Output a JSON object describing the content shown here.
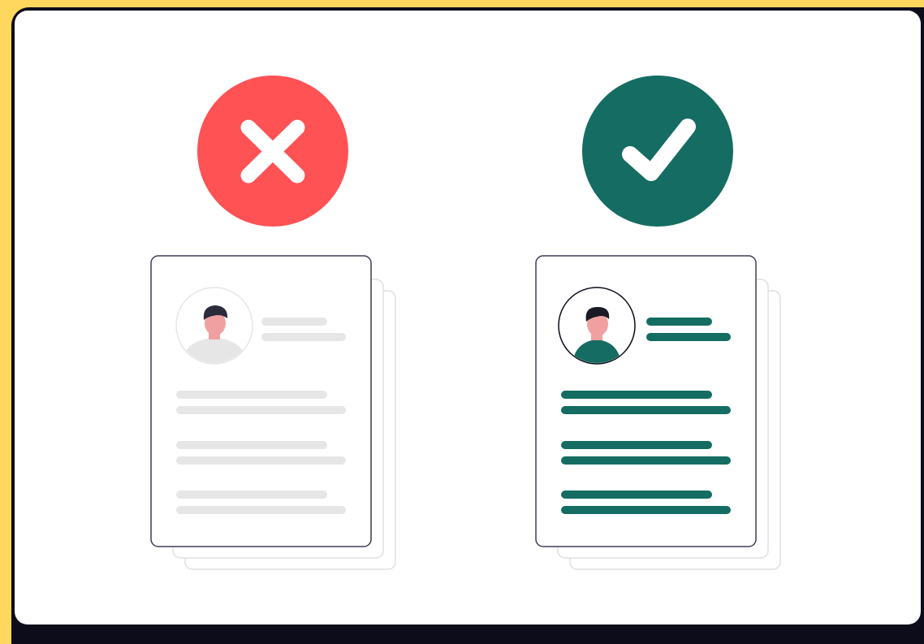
{
  "colors": {
    "background": "#ffd75e",
    "frame": "#0d0c1a",
    "card": "#ffffff",
    "reject": "#ff5255",
    "approve": "#146c62",
    "placeholder_line": "#e6e6e6",
    "skin": "#f0a0a0",
    "hair": "#2b2b3a"
  },
  "icons": {
    "reject": "x-mark-icon",
    "approve": "check-mark-icon"
  },
  "resumes": [
    {
      "variant": "rejected",
      "icon": "x-mark-icon",
      "style": "greyed-out"
    },
    {
      "variant": "approved",
      "icon": "check-mark-icon",
      "style": "highlighted"
    }
  ]
}
